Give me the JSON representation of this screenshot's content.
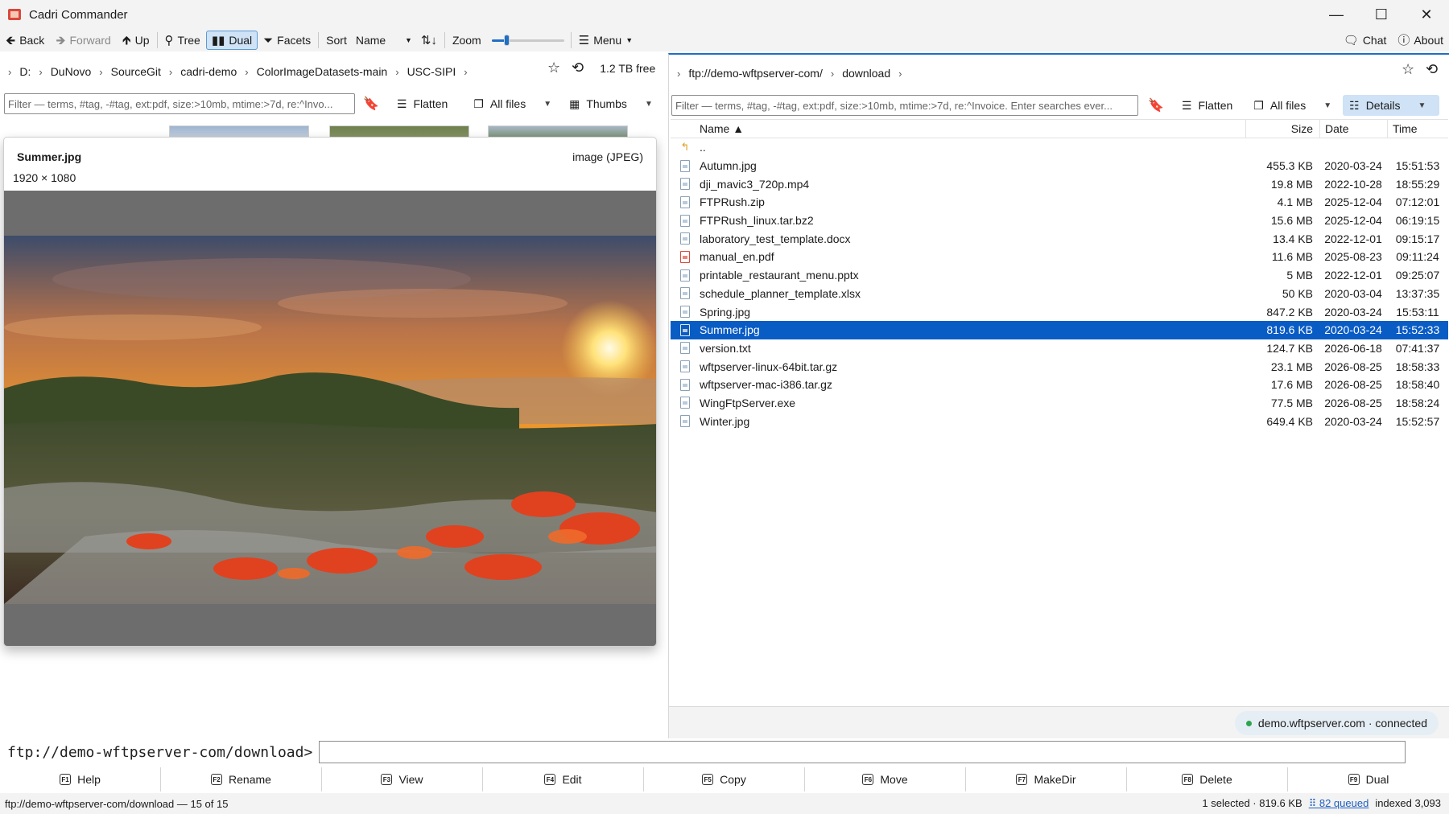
{
  "window": {
    "title": "Cadri Commander",
    "minimize": "—",
    "maximize": "☐",
    "close": "✕"
  },
  "toolbar": {
    "back": "Back",
    "forward": "Forward",
    "up": "Up",
    "tree": "Tree",
    "dual": "Dual",
    "facets": "Facets",
    "sort_label": "Sort",
    "sort_value": "Name",
    "zoom_label": "Zoom",
    "zoom_level": 0.2,
    "menu": "Menu",
    "chat": "Chat",
    "about": "About"
  },
  "left": {
    "breadcrumbs": [
      "D:",
      "DuNovo",
      "SourceGit",
      "cadri-demo",
      "ColorImageDatasets-main",
      "USC-SIPI"
    ],
    "free_space": "1.2 TB free",
    "filter_placeholder": "Filter — terms, #tag, -#tag, ext:pdf, size:>10mb, mtime:>7d, re:^Invo...",
    "flatten": "Flatten",
    "scope": "All files",
    "view_mode": "Thumbs",
    "preview": {
      "name": "Summer.jpg",
      "type": "image (JPEG)",
      "dims": "1920 × 1080"
    }
  },
  "right": {
    "breadcrumbs": [
      "ftp://demo-wftpserver-com/",
      "download"
    ],
    "filter_placeholder": "Filter — terms, #tag, -#tag, ext:pdf, size:>10mb, mtime:>7d, re:^Invoice. Enter searches ever...",
    "flatten": "Flatten",
    "scope": "All files",
    "view_mode": "Details",
    "columns": {
      "name": "Name ▲",
      "size": "Size",
      "date": "Date",
      "time": "Time"
    },
    "up_dir": "..",
    "files": [
      {
        "name": "Autumn.jpg",
        "size": "455.3 KB",
        "date": "2020-03-24",
        "time": "15:51:53",
        "kind": "img"
      },
      {
        "name": "dji_mavic3_720p.mp4",
        "size": "19.8 MB",
        "date": "2022-10-28",
        "time": "18:55:29",
        "kind": "mp4"
      },
      {
        "name": "FTPRush.zip",
        "size": "4.1 MB",
        "date": "2025-12-04",
        "time": "07:12:01",
        "kind": "zip"
      },
      {
        "name": "FTPRush_linux.tar.bz2",
        "size": "15.6 MB",
        "date": "2025-12-04",
        "time": "06:19:15",
        "kind": "arc"
      },
      {
        "name": "laboratory_test_template.docx",
        "size": "13.4 KB",
        "date": "2022-12-01",
        "time": "09:15:17",
        "kind": "doc"
      },
      {
        "name": "manual_en.pdf",
        "size": "11.6 MB",
        "date": "2025-08-23",
        "time": "09:11:24",
        "kind": "pdf"
      },
      {
        "name": "printable_restaurant_menu.pptx",
        "size": "5 MB",
        "date": "2022-12-01",
        "time": "09:25:07",
        "kind": "ppt"
      },
      {
        "name": "schedule_planner_template.xlsx",
        "size": "50 KB",
        "date": "2020-03-04",
        "time": "13:37:35",
        "kind": "xls"
      },
      {
        "name": "Spring.jpg",
        "size": "847.2 KB",
        "date": "2020-03-24",
        "time": "15:53:11",
        "kind": "img"
      },
      {
        "name": "Summer.jpg",
        "size": "819.6 KB",
        "date": "2020-03-24",
        "time": "15:52:33",
        "kind": "img",
        "selected": true
      },
      {
        "name": "version.txt",
        "size": "124.7 KB",
        "date": "2026-06-18",
        "time": "07:41:37",
        "kind": "txt"
      },
      {
        "name": "wftpserver-linux-64bit.tar.gz",
        "size": "23.1 MB",
        "date": "2026-08-25",
        "time": "18:58:33",
        "kind": "arc"
      },
      {
        "name": "wftpserver-mac-i386.tar.gz",
        "size": "17.6 MB",
        "date": "2026-08-25",
        "time": "18:58:40",
        "kind": "arc"
      },
      {
        "name": "WingFtpServer.exe",
        "size": "77.5 MB",
        "date": "2026-08-25",
        "time": "18:58:24",
        "kind": "exe"
      },
      {
        "name": "Winter.jpg",
        "size": "649.4 KB",
        "date": "2020-03-24",
        "time": "15:52:57",
        "kind": "img"
      }
    ],
    "connection": "demo.wftpserver.com · connected"
  },
  "cmdline": {
    "prompt": "ftp://demo-wftpserver-com/download>"
  },
  "fkeys": [
    {
      "key": "F1",
      "label": "Help"
    },
    {
      "key": "F2",
      "label": "Rename"
    },
    {
      "key": "F3",
      "label": "View"
    },
    {
      "key": "F4",
      "label": "Edit"
    },
    {
      "key": "F5",
      "label": "Copy"
    },
    {
      "key": "F6",
      "label": "Move"
    },
    {
      "key": "F7",
      "label": "MakeDir"
    },
    {
      "key": "F8",
      "label": "Delete"
    },
    {
      "key": "F9",
      "label": "Dual"
    }
  ],
  "status": {
    "left": "ftp://demo-wftpserver-com/download — 15 of 15",
    "selected": "1 selected · 819.6 KB",
    "queued": "⠿ 82 queued",
    "indexed": "indexed 3,093"
  },
  "colors": {
    "accent": "#0a5cc5",
    "panel": "#f3f3f3",
    "connected": "#2ea44f"
  }
}
